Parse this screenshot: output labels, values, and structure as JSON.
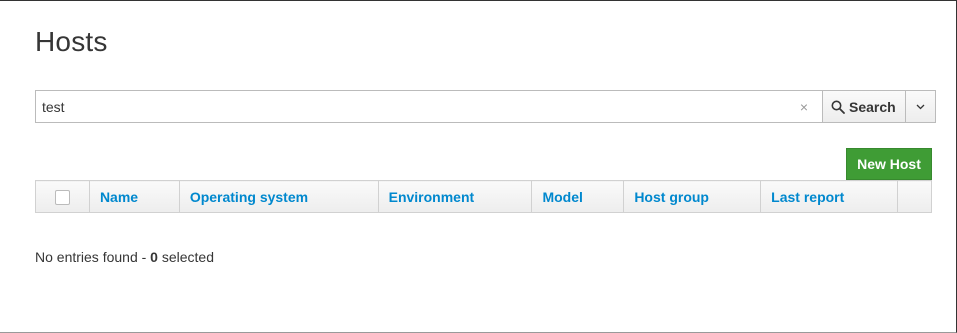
{
  "page": {
    "title": "Hosts"
  },
  "search": {
    "value": "test",
    "clear_glyph": "×",
    "button_label": "Search",
    "button_icon": "search-icon",
    "dropdown_icon": "chevron-down-icon"
  },
  "toolbar": {
    "new_host_label": "New Host",
    "new_host_color": "#3f9c35"
  },
  "table": {
    "columns": [
      "Name",
      "Operating system",
      "Environment",
      "Model",
      "Host group",
      "Last report",
      ""
    ]
  },
  "status": {
    "prefix": "No entries found - ",
    "selected_count": "0",
    "suffix": " selected"
  },
  "colors": {
    "link": "#0088ce",
    "text": "#363636"
  }
}
